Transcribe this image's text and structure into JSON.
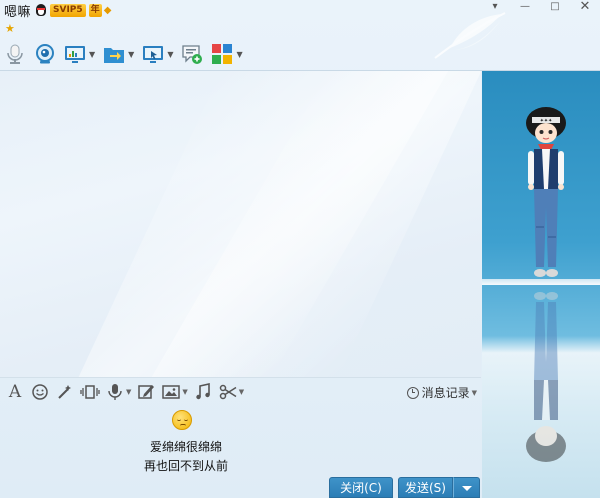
{
  "titlebar": {
    "nickname": "嗯嘛",
    "svip_badge": "SVIP5",
    "year_badge": "年",
    "star": "★"
  },
  "window_controls": {
    "menu": "▾",
    "minimize": "—",
    "maximize": "□",
    "close": "✕"
  },
  "toolbar": {
    "items": [
      {
        "icon": "microphone-icon",
        "has_dropdown": false
      },
      {
        "icon": "webcam-icon",
        "has_dropdown": false
      },
      {
        "icon": "remote-desktop-icon",
        "has_dropdown": true
      },
      {
        "icon": "send-file-icon",
        "has_dropdown": true
      },
      {
        "icon": "screen-share-icon",
        "has_dropdown": true
      },
      {
        "icon": "create-group-icon",
        "has_dropdown": false
      },
      {
        "icon": "apps-icon",
        "has_dropdown": true
      }
    ]
  },
  "input_toolbar": {
    "font_label": "A",
    "history_label": "消息记录"
  },
  "input": {
    "line1": "爱绵绵很绵绵",
    "line2": "再也回不到从前"
  },
  "buttons": {
    "close_label": "关闭(C)",
    "send_label": "发送(S)"
  },
  "colors": {
    "button_blue": "#3388c2",
    "sky_blue": "#2a8dbf",
    "badge_gold": "#f2a400"
  }
}
